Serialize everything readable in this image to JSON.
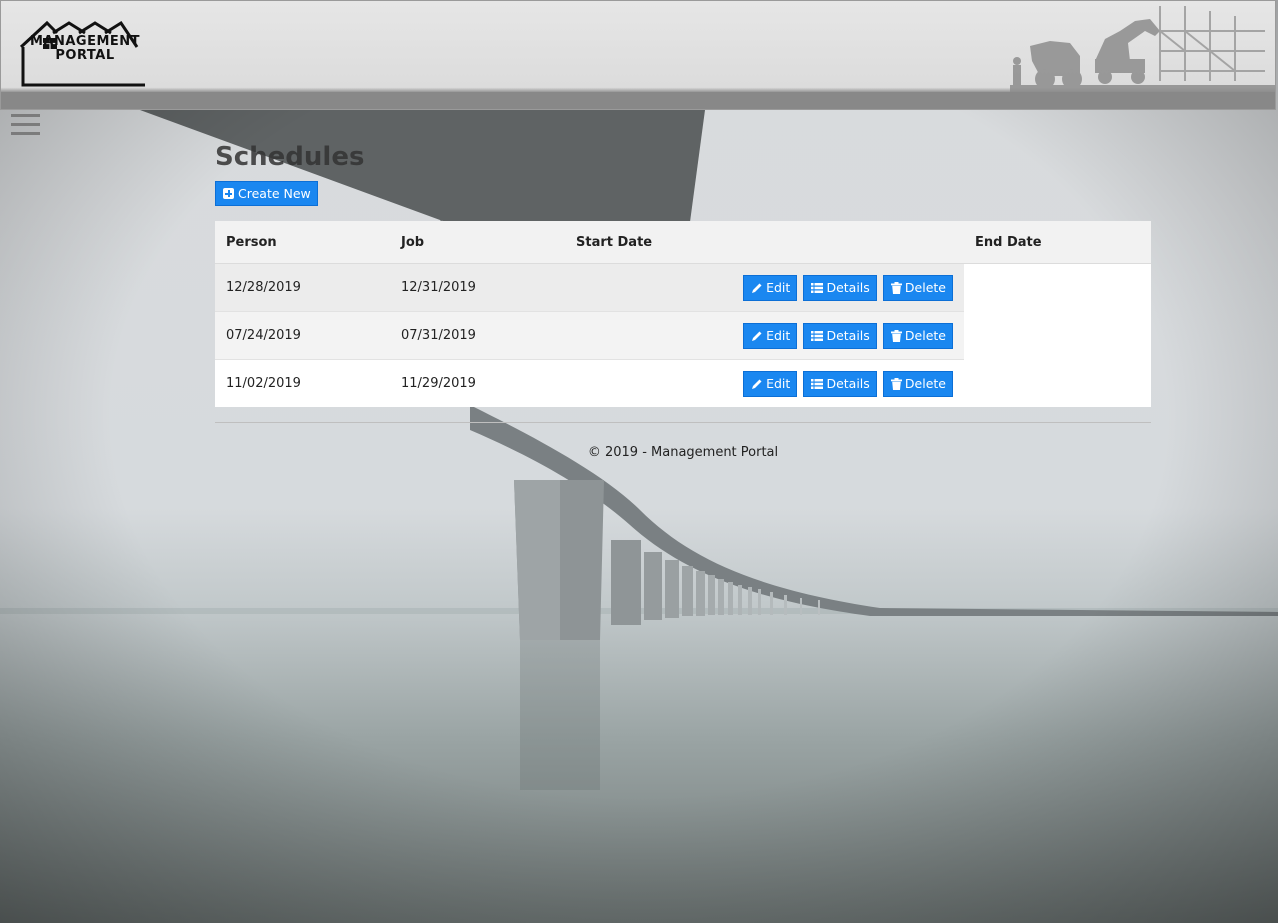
{
  "header": {
    "logo_line1": "MANAGEMENT",
    "logo_line2": "PORTAL"
  },
  "page": {
    "title": "Schedules",
    "create_label": "Create New"
  },
  "table": {
    "columns": [
      "Person",
      "Job",
      "Start Date",
      "End Date"
    ],
    "rows": [
      {
        "person": "12/28/2019",
        "job": "12/31/2019"
      },
      {
        "person": "07/24/2019",
        "job": "07/31/2019"
      },
      {
        "person": "11/02/2019",
        "job": "11/29/2019"
      }
    ],
    "actions": {
      "edit": "Edit",
      "details": "Details",
      "delete": "Delete"
    }
  },
  "footer": {
    "text": "© 2019 - Management Portal"
  },
  "colors": {
    "accent": "#1a87f0",
    "header_bg": "#e2e2e2",
    "header_band": "#888888"
  },
  "icons": {
    "menu": "hamburger-icon",
    "create": "plus-square-icon",
    "edit": "pencil-icon",
    "details": "list-icon",
    "delete": "trash-icon"
  }
}
